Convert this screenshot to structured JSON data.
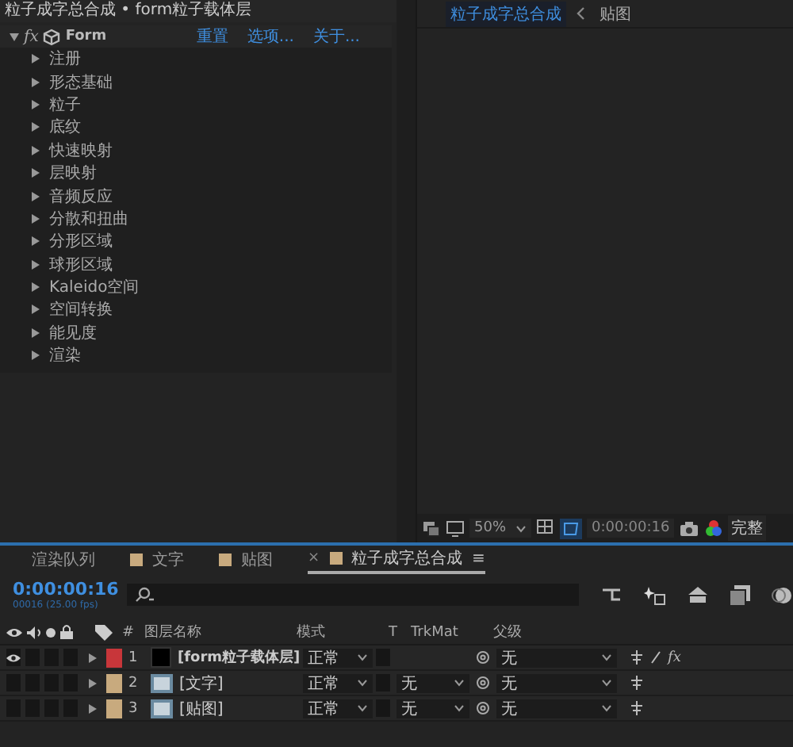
{
  "effect_panel": {
    "title": "粒子成字总合成 • form粒子载体层",
    "effect": {
      "fx": "fx",
      "name": "Form",
      "expanded": true,
      "links": [
        "重置",
        "选项...",
        "关于..."
      ]
    },
    "groups": [
      {
        "label": "注册",
        "expanded": false
      },
      {
        "label": "形态基础",
        "expanded": false
      },
      {
        "label": "粒子",
        "expanded": false
      },
      {
        "label": "底纹",
        "expanded": false
      },
      {
        "label": "快速映射",
        "expanded": false
      },
      {
        "label": "层映射",
        "expanded": false
      },
      {
        "label": "音频反应",
        "expanded": false
      },
      {
        "label": "分散和扭曲",
        "expanded": false
      },
      {
        "label": "分形区域",
        "expanded": false
      },
      {
        "label": "球形区域",
        "expanded": false
      },
      {
        "label": "Kaleido空间",
        "expanded": false
      },
      {
        "label": "空间转换",
        "expanded": false
      },
      {
        "label": "能见度",
        "expanded": false
      },
      {
        "label": "渲染",
        "expanded": false
      }
    ]
  },
  "viewer": {
    "tabs": [
      {
        "label": "粒子成字总合成",
        "selected": true
      },
      {
        "label": "贴图",
        "selected": false
      }
    ],
    "toolbar": {
      "zoom": "50%",
      "time": "0:00:00:16",
      "resolution": "完整"
    }
  },
  "timeline": {
    "tabs": [
      {
        "label": "渲染队列",
        "selected": false
      },
      {
        "label": "文字",
        "color": "#c8aa7e",
        "selected": false
      },
      {
        "label": "贴图",
        "color": "#c8aa7e",
        "selected": false
      },
      {
        "label": "粒子成字总合成",
        "color": "#c8aa7e",
        "selected": true,
        "close": "×",
        "menu": "≡"
      }
    ],
    "time": "0:00:00:16",
    "fps": "00016 (25.00 fps)",
    "columns": {
      "number": "#",
      "name": "图层名称",
      "mode": "模式",
      "t": "T",
      "trkmat": "TrkMat",
      "parent": "父级"
    },
    "layers": [
      {
        "number": "1",
        "name": "[form粒子载体层]",
        "kind": "solid",
        "color": "#c8363a",
        "visible": true,
        "mode": "正常",
        "parent": "无",
        "fx": "fx",
        "effects_on": true
      },
      {
        "number": "2",
        "name": "[文字]",
        "kind": "footage",
        "color": "#c8aa7e",
        "visible": false,
        "mode": "正常",
        "trkmat": "无",
        "parent": "无"
      },
      {
        "number": "3",
        "name": "[贴图]",
        "kind": "footage",
        "color": "#c8aa7e",
        "visible": false,
        "mode": "正常",
        "trkmat": "无",
        "parent": "无"
      }
    ]
  }
}
